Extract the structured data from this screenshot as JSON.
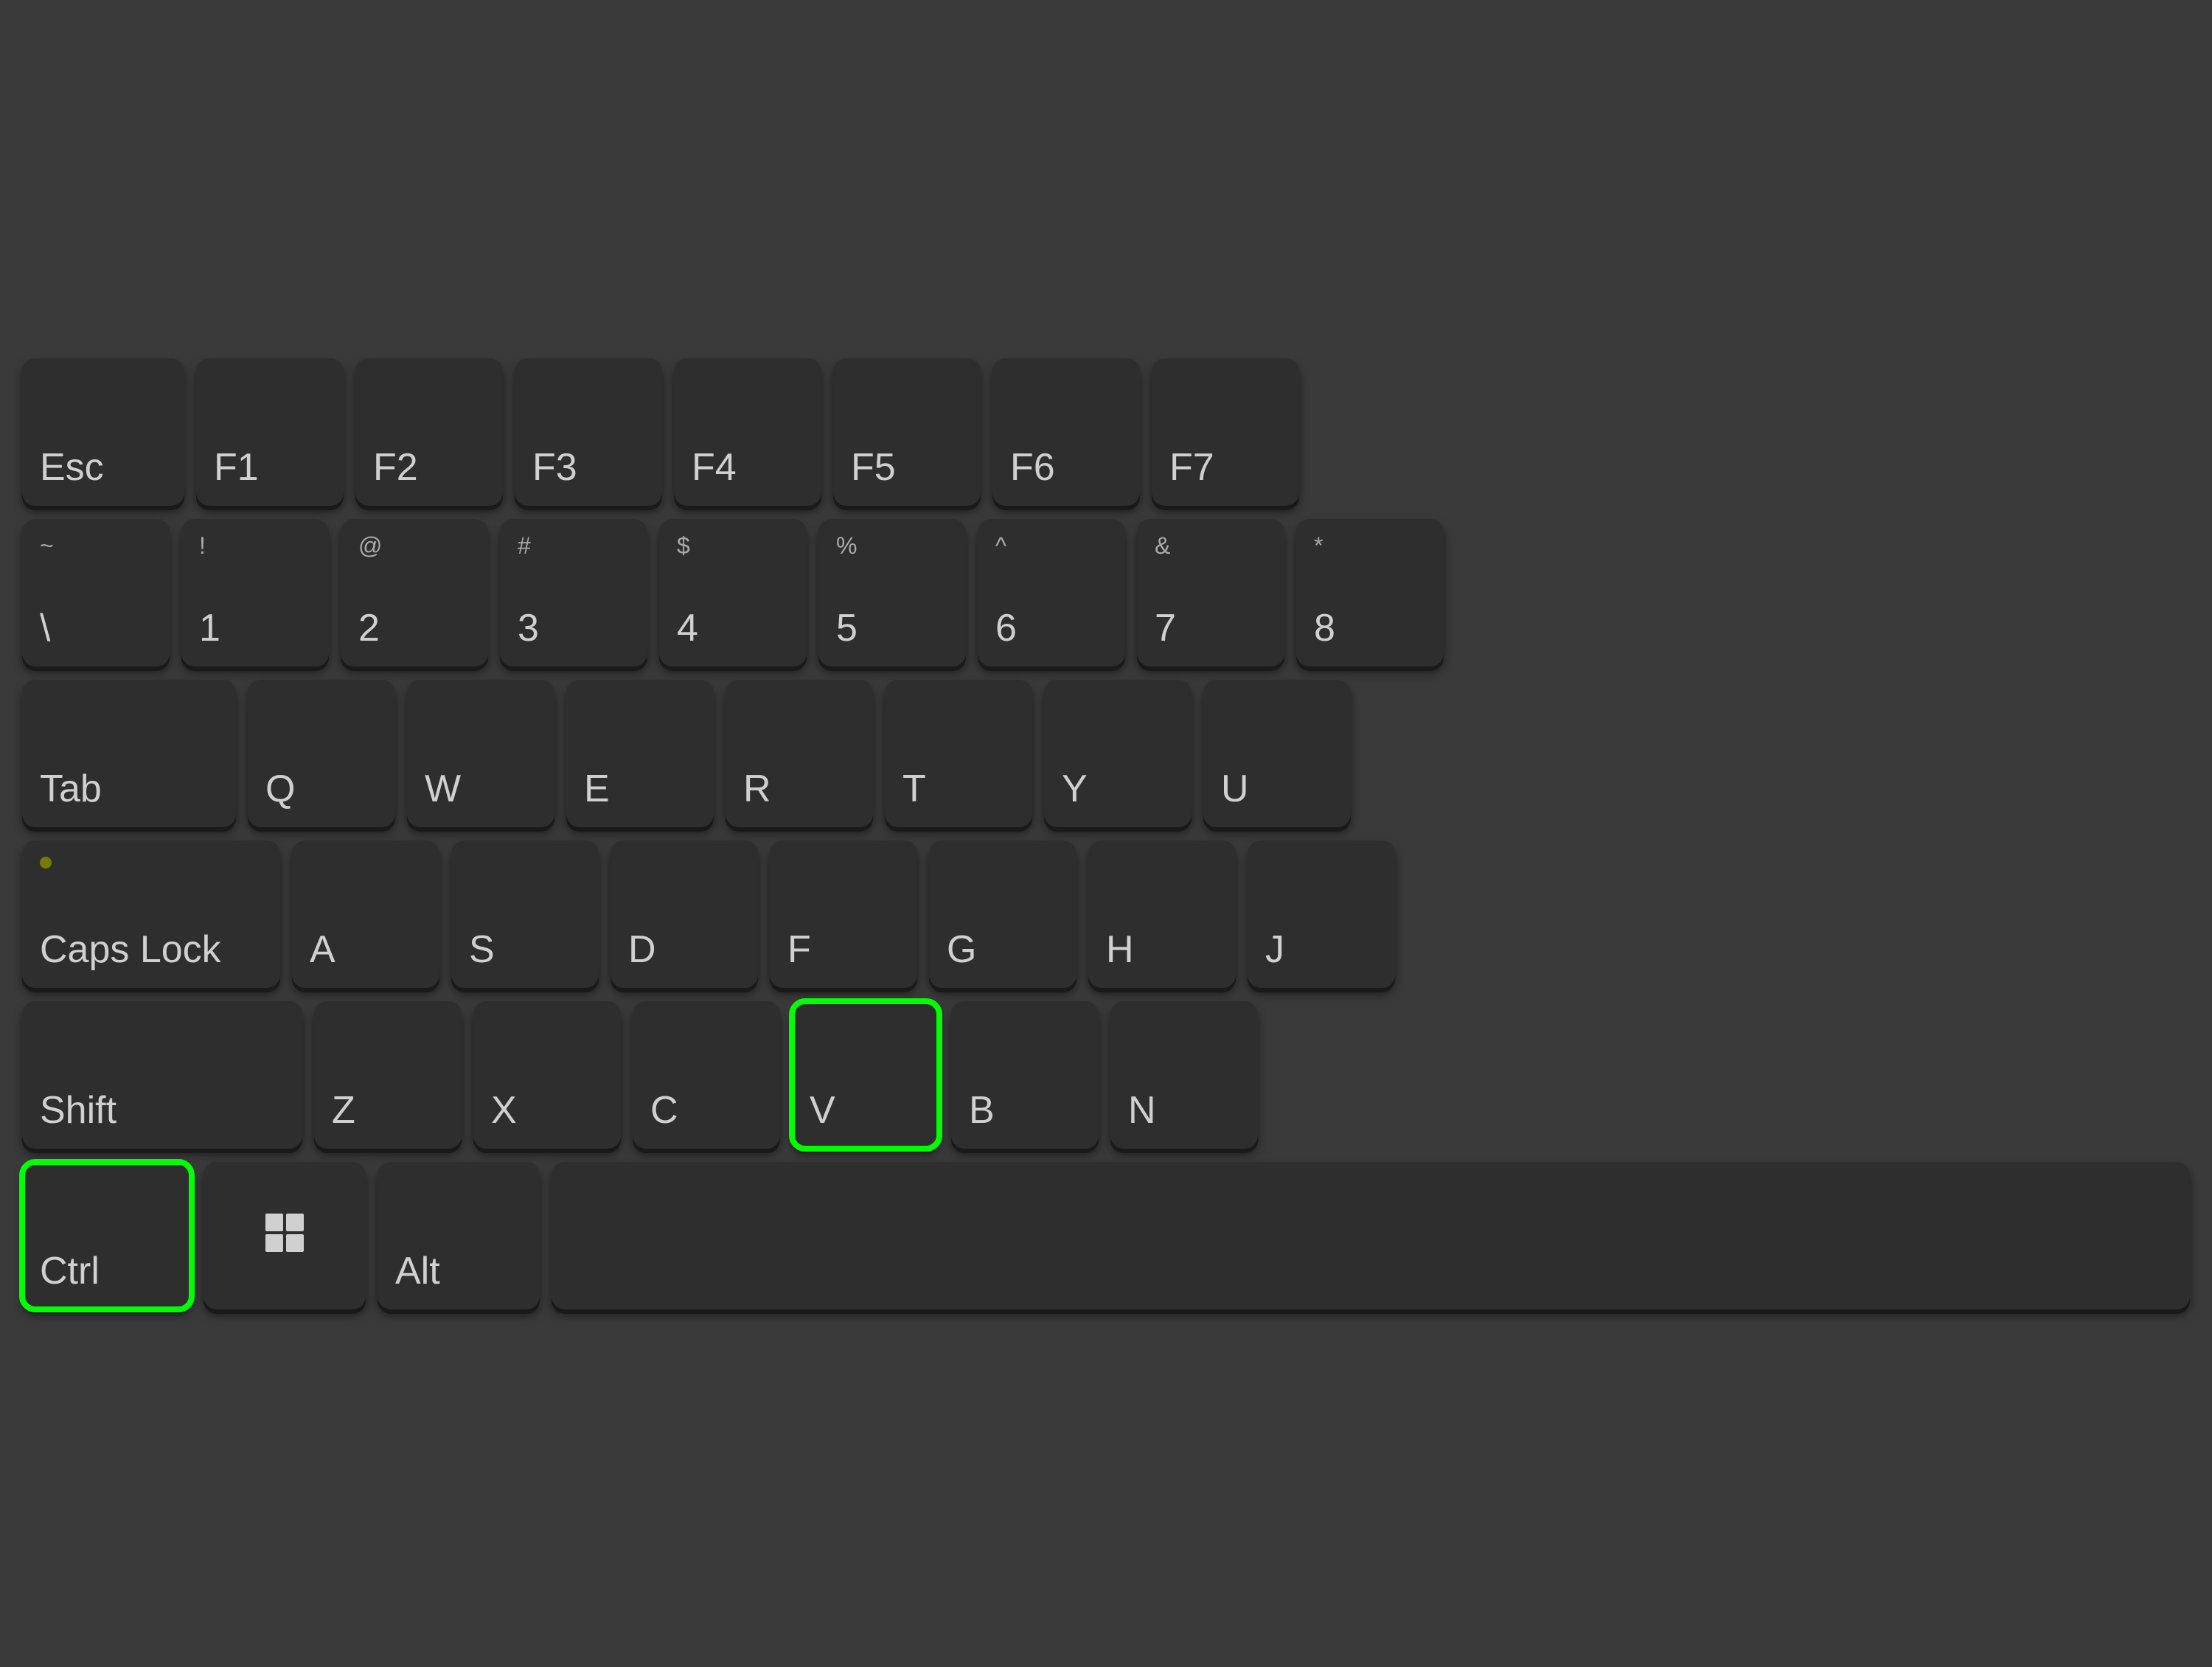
{
  "keyboard": {
    "rows": [
      {
        "id": "fn-row",
        "keys": [
          {
            "id": "esc",
            "label": "Esc",
            "size": "esc",
            "highlighted": false
          },
          {
            "id": "f1",
            "label": "F1",
            "size": "f1",
            "highlighted": false
          },
          {
            "id": "f2",
            "label": "F2",
            "size": "f1",
            "highlighted": false
          },
          {
            "id": "f3",
            "label": "F3",
            "size": "f1",
            "highlighted": false
          },
          {
            "id": "f4",
            "label": "F4",
            "size": "f1",
            "highlighted": false
          },
          {
            "id": "f5",
            "label": "F5",
            "size": "f1",
            "highlighted": false
          },
          {
            "id": "f6",
            "label": "F6",
            "size": "f1",
            "highlighted": false
          },
          {
            "id": "f7",
            "label": "F7",
            "size": "f1",
            "partial": true,
            "highlighted": false
          }
        ]
      },
      {
        "id": "number-row",
        "keys": [
          {
            "id": "grave",
            "label": "\\",
            "sublabel": "~",
            "size": "num",
            "highlighted": false
          },
          {
            "id": "1",
            "label": "1",
            "sublabel": "!",
            "size": "num",
            "highlighted": false
          },
          {
            "id": "2",
            "label": "2",
            "sublabel": "@",
            "size": "num",
            "highlighted": false
          },
          {
            "id": "3",
            "label": "3",
            "sublabel": "#",
            "size": "num",
            "highlighted": false
          },
          {
            "id": "4",
            "label": "4",
            "sublabel": "$",
            "size": "num",
            "highlighted": false
          },
          {
            "id": "5",
            "label": "5",
            "sublabel": "%",
            "size": "num",
            "highlighted": false
          },
          {
            "id": "6",
            "label": "6",
            "sublabel": "^",
            "size": "num",
            "highlighted": false
          },
          {
            "id": "7",
            "label": "7",
            "sublabel": "&",
            "size": "num",
            "highlighted": false
          },
          {
            "id": "8",
            "label": "8",
            "sublabel": "*",
            "size": "num",
            "partial": true,
            "highlighted": false
          }
        ]
      },
      {
        "id": "qwerty-row",
        "keys": [
          {
            "id": "tab",
            "label": "Tab",
            "size": "tab",
            "highlighted": false
          },
          {
            "id": "q",
            "label": "Q",
            "size": "letter",
            "highlighted": false
          },
          {
            "id": "w",
            "label": "W",
            "size": "letter",
            "highlighted": false
          },
          {
            "id": "e",
            "label": "E",
            "size": "letter",
            "highlighted": false
          },
          {
            "id": "r",
            "label": "R",
            "size": "letter",
            "highlighted": false
          },
          {
            "id": "t",
            "label": "T",
            "size": "letter",
            "highlighted": false
          },
          {
            "id": "y",
            "label": "Y",
            "size": "letter",
            "highlighted": false
          },
          {
            "id": "u",
            "label": "U",
            "size": "letter",
            "highlighted": false
          }
        ]
      },
      {
        "id": "asdf-row",
        "keys": [
          {
            "id": "caps",
            "label": "Caps Lock",
            "size": "caps",
            "hasDot": true,
            "highlighted": false
          },
          {
            "id": "a",
            "label": "A",
            "size": "letter",
            "highlighted": false
          },
          {
            "id": "s",
            "label": "S",
            "size": "letter",
            "highlighted": false
          },
          {
            "id": "d",
            "label": "D",
            "size": "letter",
            "highlighted": false
          },
          {
            "id": "f",
            "label": "F",
            "size": "letter",
            "highlighted": false
          },
          {
            "id": "g",
            "label": "G",
            "size": "letter",
            "highlighted": false
          },
          {
            "id": "h",
            "label": "H",
            "size": "letter",
            "highlighted": false
          },
          {
            "id": "j",
            "label": "J",
            "size": "letter",
            "partial": true,
            "highlighted": false
          }
        ]
      },
      {
        "id": "zxcv-row",
        "keys": [
          {
            "id": "shift",
            "label": "Shift",
            "size": "shift",
            "highlighted": false
          },
          {
            "id": "z",
            "label": "Z",
            "size": "letter",
            "highlighted": false
          },
          {
            "id": "x",
            "label": "X",
            "size": "letter",
            "highlighted": false
          },
          {
            "id": "c",
            "label": "C",
            "size": "letter",
            "highlighted": false
          },
          {
            "id": "v",
            "label": "V",
            "size": "letter",
            "highlighted": true
          },
          {
            "id": "b",
            "label": "B",
            "size": "letter",
            "highlighted": false
          },
          {
            "id": "n",
            "label": "N",
            "size": "letter",
            "highlighted": false
          }
        ]
      },
      {
        "id": "bottom-row",
        "keys": [
          {
            "id": "ctrl",
            "label": "Ctrl",
            "size": "ctrl",
            "highlighted": true
          },
          {
            "id": "win",
            "label": "",
            "size": "win",
            "isWin": true,
            "highlighted": false
          },
          {
            "id": "alt",
            "label": "Alt",
            "size": "alt",
            "highlighted": false
          },
          {
            "id": "space",
            "label": "",
            "size": "space",
            "highlighted": false
          }
        ]
      }
    ]
  }
}
